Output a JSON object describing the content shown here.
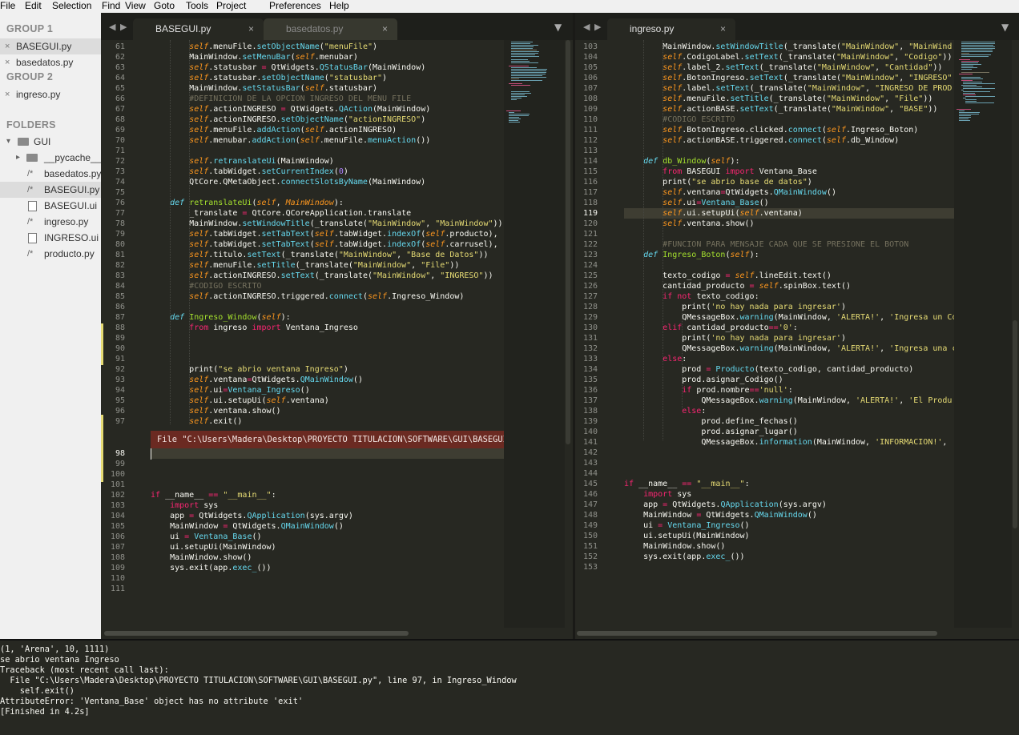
{
  "menu": [
    "File",
    "Edit",
    "Selection",
    "Find",
    "View",
    "Goto",
    "Tools",
    "Project",
    "Preferences",
    "Help"
  ],
  "sidebar": {
    "group1": "GROUP 1",
    "group1_files": [
      "BASEGUI.py",
      "basedatos.py"
    ],
    "group2": "GROUP 2",
    "group2_files": [
      "ingreso.py"
    ],
    "folders": "FOLDERS",
    "root": "GUI",
    "tree": [
      "__pycache__",
      "basedatos.py",
      "BASEGUI.py",
      "BASEGUI.ui",
      "ingreso.py",
      "INGRESO.ui",
      "producto.py"
    ]
  },
  "tabs_left": [
    "BASEGUI.py",
    "basedatos.py"
  ],
  "tabs_right": [
    "ingreso.py"
  ],
  "icons": {
    "close": "×",
    "left_arrow": "◀",
    "right_arrow": "▶",
    "dropdown": "▼",
    "folder_open": "▾",
    "folder_closed": "▸",
    "file_glyph": "/*"
  },
  "left_gutter": [
    "61",
    "62",
    "63",
    "64",
    "65",
    "66",
    "67",
    "68",
    "69",
    "70",
    "71",
    "72",
    "73",
    "74",
    "75",
    "76",
    "77",
    "78",
    "79",
    "80",
    "81",
    "82",
    "83",
    "84",
    "85",
    "86",
    "87",
    "88",
    "89",
    "90",
    "91",
    "92",
    "93",
    "94",
    "95",
    "96",
    "97",
    "",
    "",
    "98",
    "99",
    "100",
    "101",
    "102",
    "103",
    "104",
    "105",
    "106",
    "107",
    "108",
    "109",
    "110",
    "111"
  ],
  "left_code": [
    "        self.menuFile.setObjectName(\"menuFile\")",
    "        MainWindow.setMenuBar(self.menubar)",
    "        self.statusbar = QtWidgets.QStatusBar(MainWindow)",
    "        self.statusbar.setObjectName(\"statusbar\")",
    "        MainWindow.setStatusBar(self.statusbar)",
    "        #DEFINICION DE LA OPCION INGRESO DEL MENU FILE",
    "        self.actionINGRESO = QtWidgets.QAction(MainWindow)",
    "        self.actionINGRESO.setObjectName(\"actionINGRESO\")",
    "        self.menuFile.addAction(self.actionINGRESO)",
    "        self.menubar.addAction(self.menuFile.menuAction())",
    "",
    "        self.retranslateUi(MainWindow)",
    "        self.tabWidget.setCurrentIndex(0)",
    "        QtCore.QMetaObject.connectSlotsByName(MainWindow)",
    "",
    "    def retranslateUi(self, MainWindow):",
    "        _translate = QtCore.QCoreApplication.translate",
    "        MainWindow.setWindowTitle(_translate(\"MainWindow\", \"MainWindow\"))",
    "        self.tabWidget.setTabText(self.tabWidget.indexOf(self.producto),",
    "        self.tabWidget.setTabText(self.tabWidget.indexOf(self.carrusel),",
    "        self.titulo.setText(_translate(\"MainWindow\", \"Base de Datos\"))",
    "        self.menuFile.setTitle(_translate(\"MainWindow\", \"File\"))",
    "        self.actionINGRESO.setText(_translate(\"MainWindow\", \"INGRESO\"))",
    "        #CODIGO ESCRITO",
    "        self.actionINGRESO.triggered.connect(self.Ingreso_Window)",
    "",
    "    def Ingreso_Window(self):",
    "        from ingreso import Ventana_Ingreso",
    "",
    "",
    "",
    "        print(\"se abrio ventana Ingreso\")",
    "        self.ventana=QtWidgets.QMainWindow()",
    "        self.ui=Ventana_Ingreso()",
    "        self.ui.setupUi(self.ventana)",
    "        self.ventana.show()",
    "        self.exit()",
    "",
    "",
    "",
    "",
    "",
    "",
    "if __name__ == \"__main__\":",
    "    import sys",
    "    app = QtWidgets.QApplication(sys.argv)",
    "    MainWindow = QtWidgets.QMainWindow()",
    "    ui = Ventana_Base()",
    "    ui.setupUi(MainWindow)",
    "    MainWindow.show()",
    "    sys.exit(app.exec_())",
    ""
  ],
  "error_popup": "File \"C:\\Users\\Madera\\Desktop\\PROYECTO TITULACION\\SOFTWARE\\GUI\\BASEGUI.p",
  "right_gutter": [
    "103",
    "104",
    "105",
    "106",
    "107",
    "108",
    "109",
    "110",
    "111",
    "112",
    "113",
    "114",
    "115",
    "116",
    "117",
    "118",
    "119",
    "120",
    "121",
    "122",
    "123",
    "124",
    "125",
    "126",
    "127",
    "128",
    "129",
    "130",
    "131",
    "132",
    "133",
    "134",
    "135",
    "136",
    "137",
    "138",
    "139",
    "140",
    "141",
    "142",
    "143",
    "144",
    "145",
    "146",
    "147",
    "148",
    "149",
    "150",
    "151",
    "152",
    "153"
  ],
  "right_code": [
    "        MainWindow.setWindowTitle(_translate(\"MainWindow\", \"MainWind",
    "        self.CodigoLabel.setText(_translate(\"MainWindow\", \"Codigo\"))",
    "        self.label_2.setText(_translate(\"MainWindow\", \"Cantidad\"))",
    "        self.BotonIngreso.setText(_translate(\"MainWindow\", \"INGRESO\"",
    "        self.label.setText(_translate(\"MainWindow\", \"INGRESO DE PROD",
    "        self.menuFile.setTitle(_translate(\"MainWindow\", \"File\"))",
    "        self.actionBASE.setText(_translate(\"MainWindow\", \"BASE\"))",
    "        #CODIGO ESCRITO",
    "        self.BotonIngreso.clicked.connect(self.Ingreso_Boton)",
    "        self.actionBASE.triggered.connect(self.db_Window)",
    "",
    "    def db_Window(self):",
    "        from BASEGUI import Ventana_Base",
    "        print(\"se abrio base de datos\")",
    "        self.ventana=QtWidgets.QMainWindow()",
    "        self.ui=Ventana_Base()",
    "        self.ui.setupUi(self.ventana)",
    "        self.ventana.show()",
    "",
    "        #FUNCION PARA MENSAJE CADA QUE SE PRESIONE EL BOTON",
    "    def Ingreso_Boton(self):",
    "",
    "        texto_codigo = self.lineEdit.text()",
    "        cantidad_producto = self.spinBox.text()",
    "        if not texto_codigo:",
    "            print('no hay nada para ingresar')",
    "            QMessageBox.warning(MainWindow, 'ALERTA!', 'Ingresa un Co",
    "        elif cantidad_producto=='0':",
    "            print('no hay nada para ingresar')",
    "            QMessageBox.warning(MainWindow, 'ALERTA!', 'Ingresa una c",
    "        else:",
    "            prod = Producto(texto_codigo, cantidad_producto)",
    "            prod.asignar_Codigo()",
    "            if prod.nombre=='null':",
    "                QMessageBox.warning(MainWindow, 'ALERTA!', 'El Produ",
    "            else:",
    "                prod.define_fechas()",
    "                prod.asignar_lugar()",
    "                QMessageBox.information(MainWindow, 'INFORMACION!',",
    "",
    "",
    "",
    "if __name__ == \"__main__\":",
    "    import sys",
    "    app = QtWidgets.QApplication(sys.argv)",
    "    MainWindow = QtWidgets.QMainWindow()",
    "    ui = Ventana_Ingreso()",
    "    ui.setupUi(MainWindow)",
    "    MainWindow.show()",
    "    sys.exit(app.exec_())",
    ""
  ],
  "console": [
    "(1, 'Arena', 10, 1111)",
    "se abrio ventana Ingreso",
    "Traceback (most recent call last):",
    "  File \"C:\\Users\\Madera\\Desktop\\PROYECTO TITULACION\\SOFTWARE\\GUI\\BASEGUI.py\", line 97, in Ingreso_Window",
    "    self.exit()",
    "AttributeError: 'Ventana_Base' object has no attribute 'exit'",
    "[Finished in 4.2s]"
  ],
  "colors": {
    "bg": "#272822",
    "keyword": "#f92672",
    "func": "#66d9ef",
    "self": "#fd971f",
    "string": "#e6db74",
    "comment": "#75715e",
    "number": "#ae81ff",
    "defname": "#a6e22e",
    "error_bg": "#6b2a22"
  }
}
